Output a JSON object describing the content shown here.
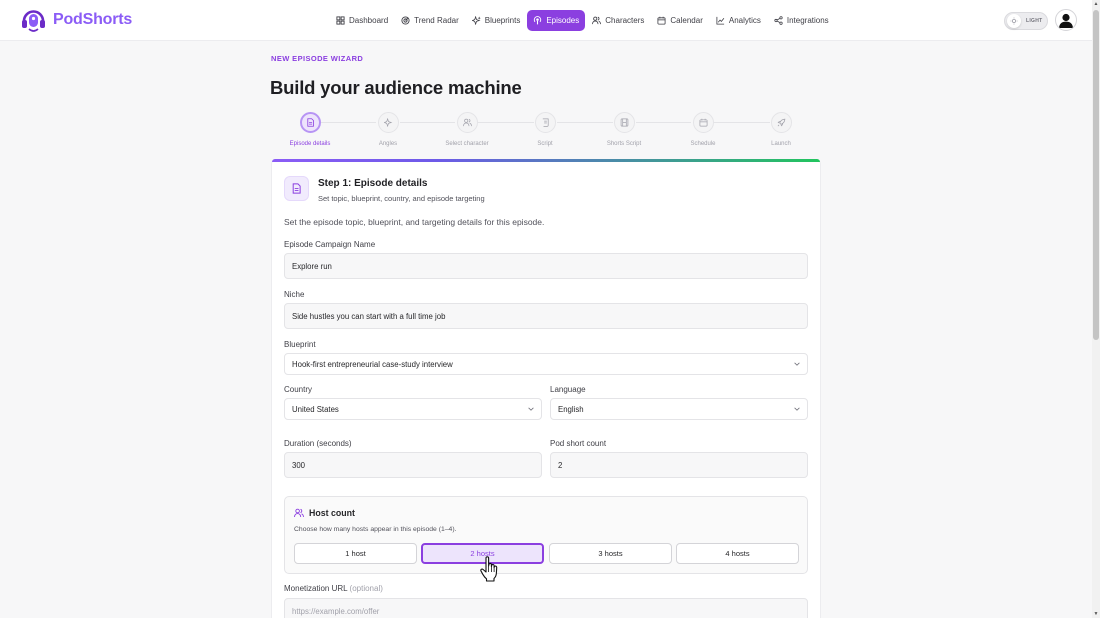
{
  "brand": {
    "name": "PodShorts",
    "accent": "#8b3fe0"
  },
  "nav": {
    "items": [
      {
        "label": "Dashboard",
        "icon": "dashboard-icon"
      },
      {
        "label": "Trend Radar",
        "icon": "radar-icon"
      },
      {
        "label": "Blueprints",
        "icon": "sparkle-icon"
      },
      {
        "label": "Episodes",
        "icon": "podcast-icon",
        "active": true
      },
      {
        "label": "Characters",
        "icon": "users-icon"
      },
      {
        "label": "Calendar",
        "icon": "calendar-icon"
      },
      {
        "label": "Analytics",
        "icon": "chart-icon"
      },
      {
        "label": "Integrations",
        "icon": "share-icon"
      }
    ],
    "theme_label": "LIGHT"
  },
  "page": {
    "eyebrow": "NEW EPISODE WIZARD",
    "title": "Build your audience machine"
  },
  "steps": [
    {
      "label": "Episode details",
      "icon": "document-icon",
      "active": true
    },
    {
      "label": "Angles",
      "icon": "sparkle-icon"
    },
    {
      "label": "Select character",
      "icon": "users-icon"
    },
    {
      "label": "Script",
      "icon": "script-icon"
    },
    {
      "label": "Shorts Script",
      "icon": "film-icon"
    },
    {
      "label": "Schedule",
      "icon": "calendar-icon"
    },
    {
      "label": "Launch",
      "icon": "rocket-icon"
    }
  ],
  "card": {
    "title": "Step 1: Episode details",
    "subtitle": "Set topic, blueprint, country, and episode targeting",
    "description": "Set the episode topic, blueprint, and targeting details for this episode."
  },
  "form": {
    "campaign_label": "Episode Campaign Name",
    "campaign_value": "Explore run",
    "niche_label": "Niche",
    "niche_value": "Side hustles you can start with a full time job",
    "blueprint_label": "Blueprint",
    "blueprint_value": "Hook-first entrepreneurial case-study interview",
    "country_label": "Country",
    "country_value": "United States",
    "language_label": "Language",
    "language_value": "English",
    "duration_label": "Duration (seconds)",
    "duration_value": "300",
    "shorts_label": "Pod short count",
    "shorts_value": "2",
    "monetization_label": "Monetization URL",
    "monetization_optional": "(optional)",
    "monetization_placeholder": "https://example.com/offer"
  },
  "host": {
    "title": "Host count",
    "subtitle": "Choose how many hosts appear in this episode (1–4).",
    "options": [
      "1 host",
      "2 hosts",
      "3 hosts",
      "4 hosts"
    ],
    "selected": 1
  }
}
